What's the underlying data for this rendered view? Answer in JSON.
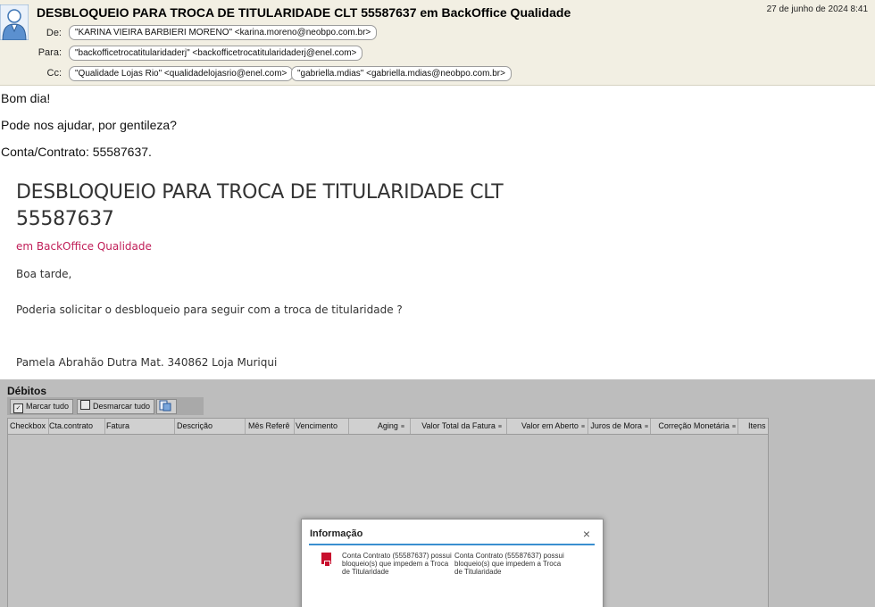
{
  "email": {
    "subject": "DESBLOQUEIO PARA TROCA DE TITULARIDADE CLT 55587637 em BackOffice Qualidade",
    "date": "27 de junho de 2024 8:41",
    "from_label": "De:",
    "to_label": "Para:",
    "cc_label": "Cc:",
    "from": "\"KARINA VIEIRA BARBIERI MORENO\" <karina.moreno@neobpo.com.br>",
    "to": "\"backofficetrocatitularidaderj\" <backofficetrocatitularidaderj@enel.com>",
    "cc": [
      "\"Qualidade Lojas Rio\" <qualidadelojasrio@enel.com>",
      "\"gabriella.mdias\" <gabriella.mdias@neobpo.com.br>"
    ],
    "body": [
      "Bom dia!",
      "Pode nos ajudar, por gentileza?",
      "Conta/Contrato: 55587637."
    ]
  },
  "forwarded": {
    "title": "DESBLOQUEIO PARA TROCA DE TITULARIDADE CLT 55587637",
    "subtitle": "em BackOffice Qualidade",
    "greeting": "Boa tarde,",
    "message": "Poderia solicitar o desbloqueio para seguir com a troca de titularidade ?",
    "signature": "Pamela Abrahão Dutra Mat. 340862 Loja Muriqui"
  },
  "screenshot": {
    "section_title": "Débitos",
    "buttons": {
      "mark_all": "Marcar tudo",
      "unmark_all": "Desmarcar tudo"
    },
    "columns": [
      "Checkbox",
      "Cta.contrato",
      "Fatura",
      "Descrição",
      "Mês Referê",
      "Vencimento",
      "Aging",
      "Valor Total da Fatura",
      "Valor em Aberto",
      "Juros de Mora",
      "Correção Monetária",
      "Itens"
    ],
    "dialog": {
      "title": "Informação",
      "close": "×",
      "message": "Conta Contrato (55587637) possui bloqueio(s) que impedem a Troca de Titularidade"
    }
  },
  "colors": {
    "header_bg": "#f2efe3",
    "subtitle": "#c01e58",
    "dialog_accent": "#3a8fd0",
    "error_icon": "#c8102e"
  },
  "icons": [
    "contact-avatar-icon",
    "checklist-icon",
    "uncheck-icon",
    "export-icon",
    "error-icon",
    "close-icon"
  ]
}
